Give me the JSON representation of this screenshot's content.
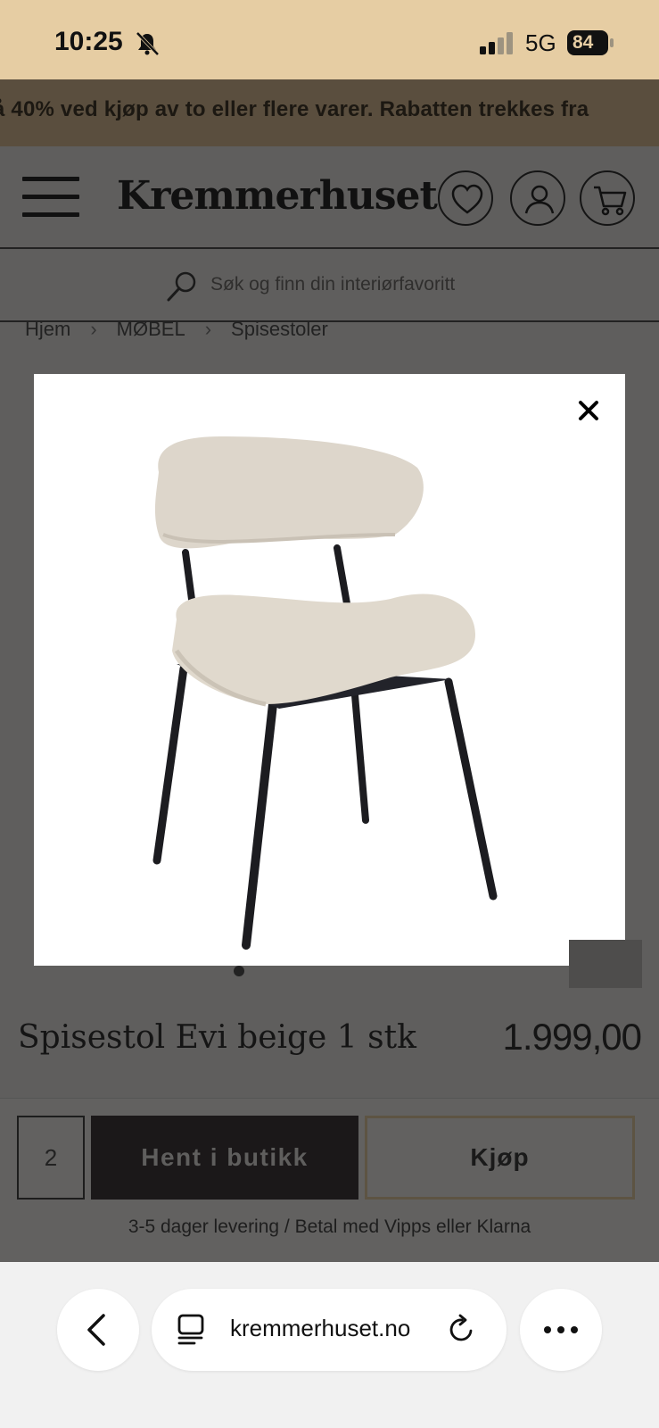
{
  "status_bar": {
    "time": "10:25",
    "network": "5G",
    "battery": "84"
  },
  "promo": {
    "text": "å 40% ved kjøp av to eller flere varer. Rabatten trekkes fra"
  },
  "header": {
    "logo": "Kremmerhuset"
  },
  "search": {
    "placeholder": "Søk og finn din interiørfavoritt"
  },
  "breadcrumb": {
    "items": [
      "Hjem",
      "MØBEL",
      "Spisestoler"
    ]
  },
  "product": {
    "title": "Spisestol Evi beige 1 stk",
    "price": "1.999,00"
  },
  "buy": {
    "quantity": "2",
    "store_button": "Hent i butikk",
    "buy_button": "Kjøp",
    "delivery_text": "3-5 dager levering / Betal med Vipps eller Klarna"
  },
  "browser": {
    "url": "kremmerhuset.no"
  },
  "colors": {
    "status_bg": "#e6cda3",
    "promo_bg": "#5a4e3e",
    "overlay": "#5f5e5d",
    "store_button_bg": "#1b1819",
    "buy_button_border": "#5d5443"
  }
}
